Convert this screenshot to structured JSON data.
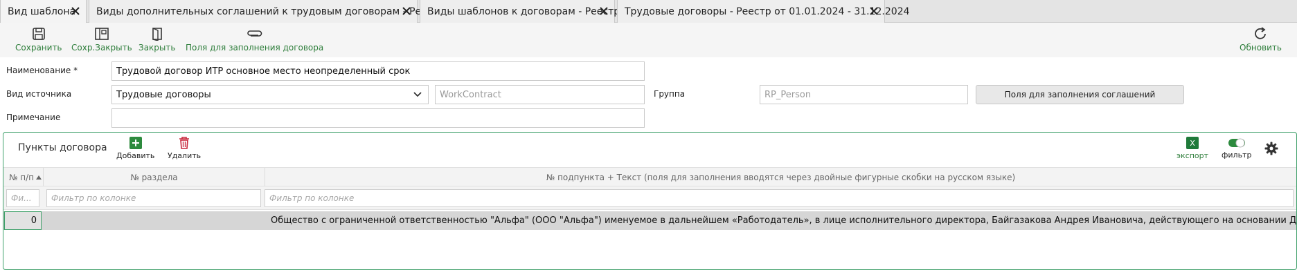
{
  "tabs": [
    {
      "label": "Вид шаблона",
      "active": true
    },
    {
      "label": "Виды дополнительных соглашений к трудовым договорам - Реестр",
      "active": false
    },
    {
      "label": "Виды шаблонов к договорам - Реестр",
      "active": false
    },
    {
      "label": "Трудовые договоры - Реестр от 01.01.2024 - 31.12.2024",
      "active": false
    }
  ],
  "toolbar": {
    "save_label": "Сохранить",
    "save_close_label": "Сохр.Закрыть",
    "close_label": "Закрыть",
    "fill_fields_label": "Поля для заполнения договора",
    "refresh_label": "Обновить"
  },
  "form": {
    "name_label": "Наименование *",
    "name_value": "Трудовой договор ИТР основное  место неопределенный срок",
    "source_label": "Вид источника",
    "source_value": "Трудовые договоры",
    "source_code": "WorkContract",
    "group_label": "Группа",
    "group_value": "RP_Person",
    "agreements_button": "Поля для заполнения соглашений",
    "note_label": "Примечание",
    "note_value": ""
  },
  "panel": {
    "title": "Пункты договора",
    "add_label": "Добавить",
    "delete_label": "Удалить",
    "export_label": "экспорт",
    "filter_label": "фильтр",
    "filter_on": true
  },
  "grid": {
    "columns": [
      "№ п/п",
      "№ раздела",
      "№ подпункта + Текст (поля для заполнения вводятся через двойные фигурные скобки на русском языке)"
    ],
    "filter_short": "Фи...",
    "filter_placeholder": "Фильтр по колонке",
    "rows": [
      {
        "num": "0",
        "section": "",
        "text": "Общество с ограниченной ответственностью \"Альфа\" (ООО \"Альфа\") именуемое в дальнейшем «Работодатель», в лице исполнительного директора, Байгазакова Андрея Ивановича, действующего на основании Доверенности №..."
      }
    ]
  },
  "colors": {
    "accent_green": "#2d7d3a",
    "delete_red": "#c8283c",
    "panel_border": "#3fa06a"
  }
}
